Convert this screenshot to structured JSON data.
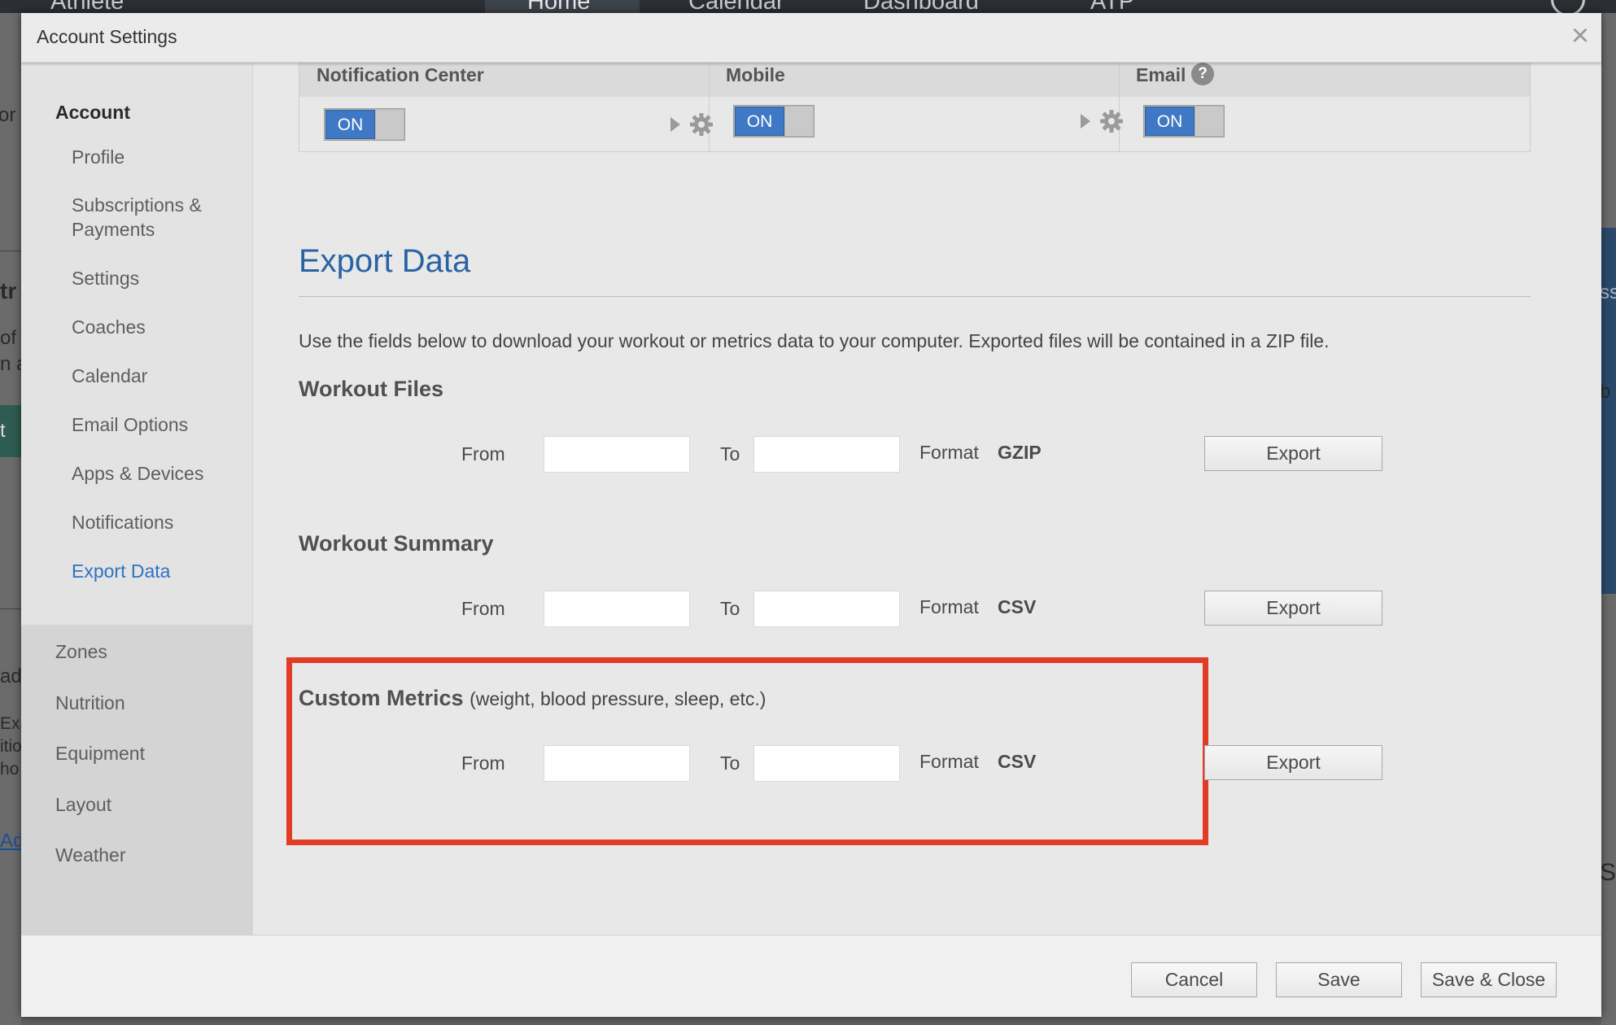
{
  "background_app": {
    "nav_items": [
      "Athlete",
      "Home",
      "Calendar",
      "Dashboard",
      "ATP"
    ],
    "left_fragments": [
      "or",
      "tr",
      "of",
      "n a",
      "t",
      "ad",
      "Exa",
      "itio",
      "ho",
      "Ad"
    ],
    "right_fragments": [
      "ss",
      "b",
      "S"
    ]
  },
  "dialog": {
    "title": "Account Settings",
    "close_icon": "close-icon"
  },
  "sidebar": {
    "section_header": "Account",
    "account_items": [
      {
        "label": "Profile"
      },
      {
        "label": "Subscriptions &"
      },
      {
        "label": "Payments"
      },
      {
        "label": "Settings"
      },
      {
        "label": "Coaches"
      },
      {
        "label": "Calendar"
      },
      {
        "label": "Email Options"
      },
      {
        "label": "Apps & Devices"
      },
      {
        "label": "Notifications"
      },
      {
        "label": "Export Data",
        "active": true
      }
    ],
    "other_items": [
      {
        "label": "Zones"
      },
      {
        "label": "Nutrition"
      },
      {
        "label": "Equipment"
      },
      {
        "label": "Layout"
      },
      {
        "label": "Weather"
      }
    ]
  },
  "notifications": {
    "columns": [
      {
        "label": "Notification Center",
        "toggle": "ON",
        "has_settings": true
      },
      {
        "label": "Mobile",
        "toggle": "ON",
        "has_settings": true
      },
      {
        "label": "Email",
        "toggle": "ON",
        "has_help": true,
        "help_symbol": "?"
      }
    ]
  },
  "export_data": {
    "title": "Export Data",
    "description": "Use the fields below to download your workout or metrics data to your computer. Exported files will be contained in a ZIP file.",
    "from_label": "From",
    "to_label": "To",
    "format_label": "Format",
    "export_button": "Export",
    "groups": [
      {
        "title": "Workout Files",
        "note": "",
        "format": "GZIP",
        "from_value": "",
        "to_value": ""
      },
      {
        "title": "Workout Summary",
        "note": "",
        "format": "CSV",
        "from_value": "",
        "to_value": ""
      },
      {
        "title": "Custom Metrics",
        "note": "(weight, blood pressure, sleep, etc.)",
        "format": "CSV",
        "from_value": "",
        "to_value": "",
        "highlighted": true
      }
    ]
  },
  "footer": {
    "cancel": "Cancel",
    "save": "Save",
    "save_close": "Save & Close"
  },
  "colors": {
    "accent": "#2f73c0",
    "toggle_on": "#3f78c4",
    "highlight": "#e23b26"
  }
}
